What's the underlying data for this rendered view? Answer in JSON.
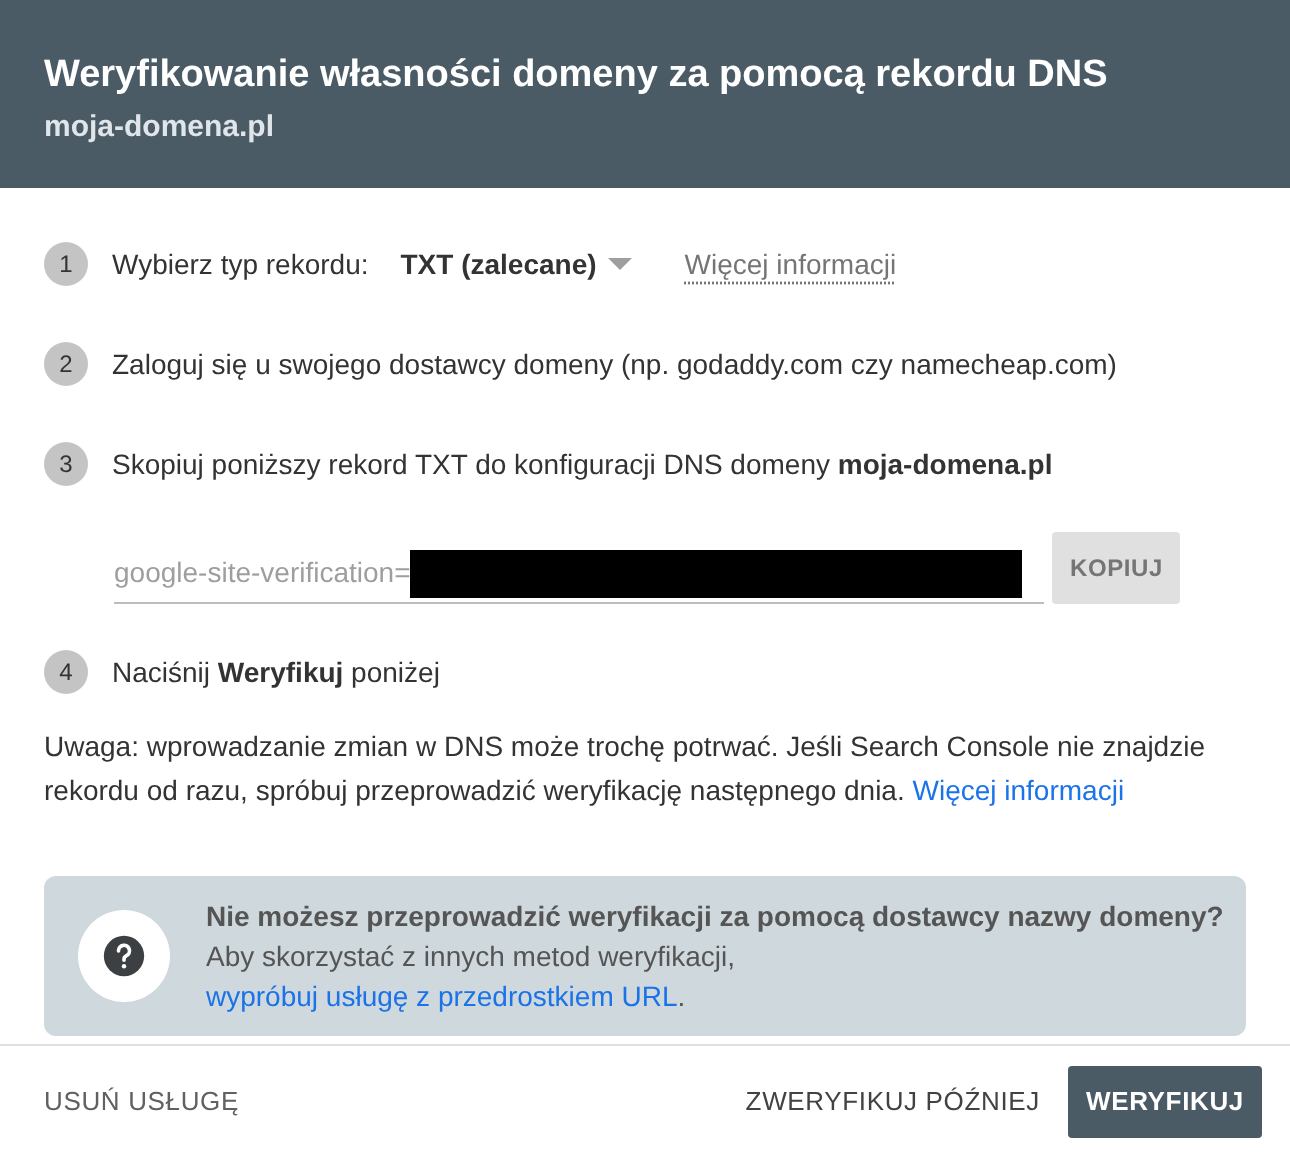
{
  "dialog": {
    "title": "Weryfikowanie własności domeny za pomocą rekordu DNS",
    "subtitle": "moja-domena.pl"
  },
  "steps": [
    {
      "kind": "select",
      "number": "1",
      "label": "Wybierz typ rekordu:",
      "select_value": "TXT (zalecane)",
      "link": "Więcej informacji"
    },
    {
      "kind": "text",
      "number": "2",
      "text": "Zaloguj się u swojego dostawcy domeny (np. godaddy.com czy namecheap.com)"
    },
    {
      "kind": "text",
      "number": "3",
      "text": "Skopiuj poniższy rekord TXT do konfiguracji DNS domeny **moja-domena.pl**"
    },
    {
      "kind": "record",
      "prefix": "google-site-verification=",
      "button": "KOPIUJ"
    },
    {
      "kind": "text",
      "number": "4",
      "text": "Naciśnij **Weryfikuj** poniżej"
    }
  ],
  "note": {
    "text": "Uwaga: wprowadzanie zmian w DNS może trochę potrwać. Jeśli Search Console nie znajdzie rekordu od razu, spróbuj przeprowadzić weryfikację następnego dnia.",
    "link": "Więcej informacji"
  },
  "info_box": {
    "title": "Nie możesz przeprowadzić weryfikacji za pomocą dostawcy nazwy domeny?",
    "text": "Aby skorzystać z innych metod weryfikacji,",
    "link": "wypróbuj usługę z przedrostkiem URL",
    "suffix": "."
  },
  "footer": {
    "left_button": "USUŃ USŁUGĘ",
    "secondary_button": "ZWERYFIKUJ PÓŹNIEJ",
    "primary_button": "WERYFIKUJ"
  }
}
